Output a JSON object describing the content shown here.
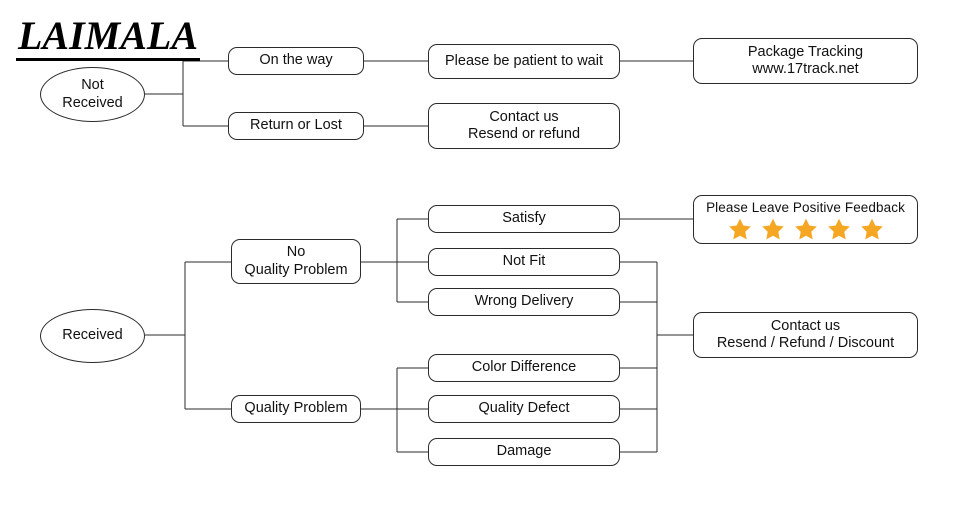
{
  "brand": {
    "logo_text": "LAIMALA"
  },
  "diagram": {
    "type": "flowchart",
    "orientation": "left-to-right",
    "accent_color": "#f5a623",
    "line_color": "#2b2b2b",
    "background": "#ffffff",
    "branches": [
      {
        "id": "not-received",
        "root_label_line1": "Not",
        "root_label_line2": "Received",
        "children": [
          {
            "id": "on-the-way",
            "label": "On the way",
            "children": [
              {
                "id": "be-patient",
                "label": "Please be patient to wait",
                "children": [
                  {
                    "id": "package-tracking",
                    "label_line1": "Package Tracking",
                    "label_line2": "www.17track.net"
                  }
                ]
              }
            ]
          },
          {
            "id": "return-or-lost",
            "label": "Return or Lost",
            "children": [
              {
                "id": "contact-resend-refund",
                "label_line1": "Contact us",
                "label_line2": "Resend or refund"
              }
            ]
          }
        ]
      },
      {
        "id": "received",
        "root_label": "Received",
        "children": [
          {
            "id": "no-quality-problem",
            "label_line1": "No",
            "label_line2": "Quality Problem",
            "children": [
              {
                "id": "satisfy",
                "label": "Satisfy",
                "goes_to": "positive-feedback"
              },
              {
                "id": "not-fit",
                "label": "Not Fit",
                "goes_to": "contact-resend-refund-discount"
              },
              {
                "id": "wrong-delivery",
                "label": "Wrong Delivery",
                "goes_to": "contact-resend-refund-discount"
              }
            ]
          },
          {
            "id": "quality-problem",
            "label": "Quality Problem",
            "children": [
              {
                "id": "color-difference",
                "label": "Color Difference",
                "goes_to": "contact-resend-refund-discount"
              },
              {
                "id": "quality-defect",
                "label": "Quality Defect",
                "goes_to": "contact-resend-refund-discount"
              },
              {
                "id": "damage",
                "label": "Damage",
                "goes_to": "contact-resend-refund-discount"
              }
            ]
          }
        ]
      }
    ],
    "outcomes": [
      {
        "id": "positive-feedback",
        "label": "Please Leave Positive Feedback",
        "stars_total": 5,
        "stars_filled": 5,
        "star_color": "#f5a623"
      },
      {
        "id": "contact-resend-refund-discount",
        "label_line1": "Contact us",
        "label_line2": "Resend / Refund / Discount"
      }
    ]
  }
}
